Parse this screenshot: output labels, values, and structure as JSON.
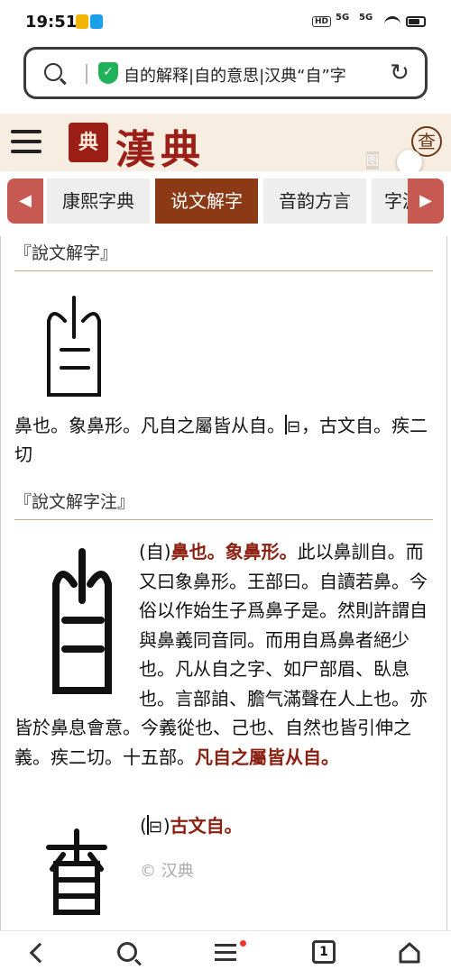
{
  "status": {
    "time": "19:51",
    "hd": "HD",
    "net1": "5G",
    "net2": "5G"
  },
  "browser": {
    "url_text": "自的解释|自的意思|汉典“自”字"
  },
  "header": {
    "logo_seal": "典",
    "logo_text": "漢典",
    "search_button": "查",
    "image_toggle_label": "图"
  },
  "tabs": [
    {
      "label": "康熙字典"
    },
    {
      "label": "说文解字"
    },
    {
      "label": "音韵方言"
    },
    {
      "label": "字源"
    }
  ],
  "shuowen": {
    "title": "『說文解字』",
    "def_part1": "鼻也。象鼻形。凡自之屬皆从自。",
    "def_part2": "，古文自。疾二切"
  },
  "zhu": {
    "title": "『說文解字注』",
    "head_open": "(自)",
    "head_bold": "鼻也。象鼻形。",
    "body": "此以鼻訓自。而又曰象鼻形。王部曰。自讀若鼻。今俗以作始生子爲鼻子是。然則許謂自與鼻義同音同。而用自爲鼻者絕少也。凡从自之字、如尸部眉、臥息也。言部詯、膽气滿聲在人上也。亦皆於鼻息會意。今義從也、己也、自然也皆引伸之義。疾二切。十五部。",
    "tail_bold": "凡自之屬皆从自。",
    "guwen_open": "(",
    "guwen_close": ")",
    "guwen_bold": "古文自。",
    "copyright": "© 汉典"
  },
  "nav": {
    "tabs_count": "1"
  },
  "colors": {
    "brand_red": "#9b1f17",
    "tab_active": "#8b3a15",
    "arrow_bg": "#c65a52",
    "highlight": "#8b1f10"
  }
}
